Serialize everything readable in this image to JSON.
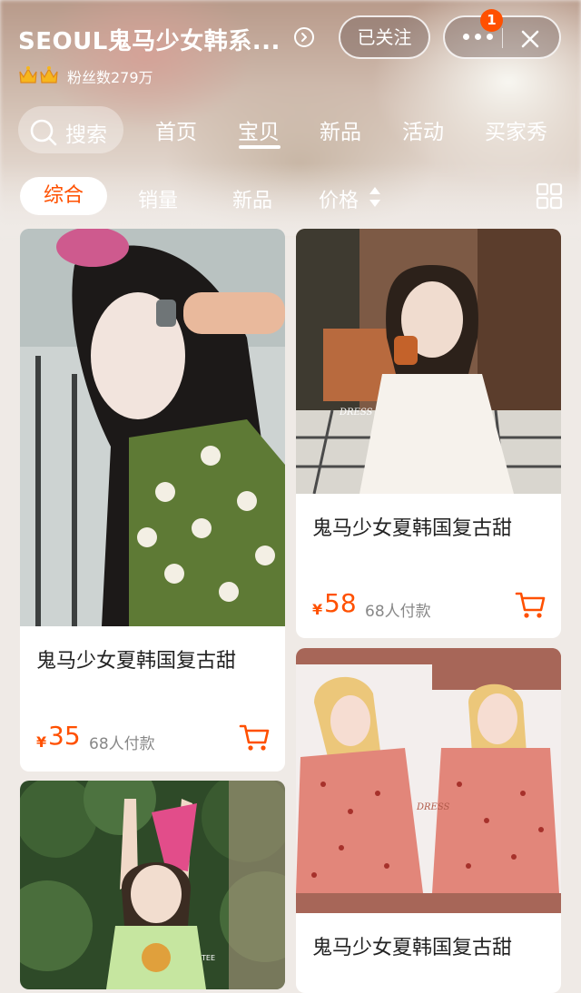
{
  "header": {
    "shop_name": "SEOUL鬼马少女韩系...",
    "fans": "粉丝数279万",
    "follow_label": "已关注",
    "notification_count": "1"
  },
  "nav": {
    "search_label": "搜索",
    "tabs": [
      "首页",
      "宝贝",
      "新品",
      "活动",
      "买家秀"
    ],
    "active_tab": "宝贝"
  },
  "filters": {
    "items": [
      "综合",
      "销量",
      "新品",
      "价格"
    ],
    "active": "综合"
  },
  "products": [
    {
      "title": "鬼马少女夏韩国复古甜",
      "currency": "¥",
      "price": "35",
      "sales": "68人付款"
    },
    {
      "title": "鬼马少女夏韩国复古甜",
      "currency": "¥",
      "price": "58",
      "sales": "68人付款"
    },
    {
      "title": "鬼马少女夏韩国复古甜"
    },
    {
      "image_label": "DRESS"
    },
    {
      "image_label": "DRESS"
    }
  ],
  "colors": {
    "accent": "#ff5000",
    "page_bg": "#efeae6"
  }
}
